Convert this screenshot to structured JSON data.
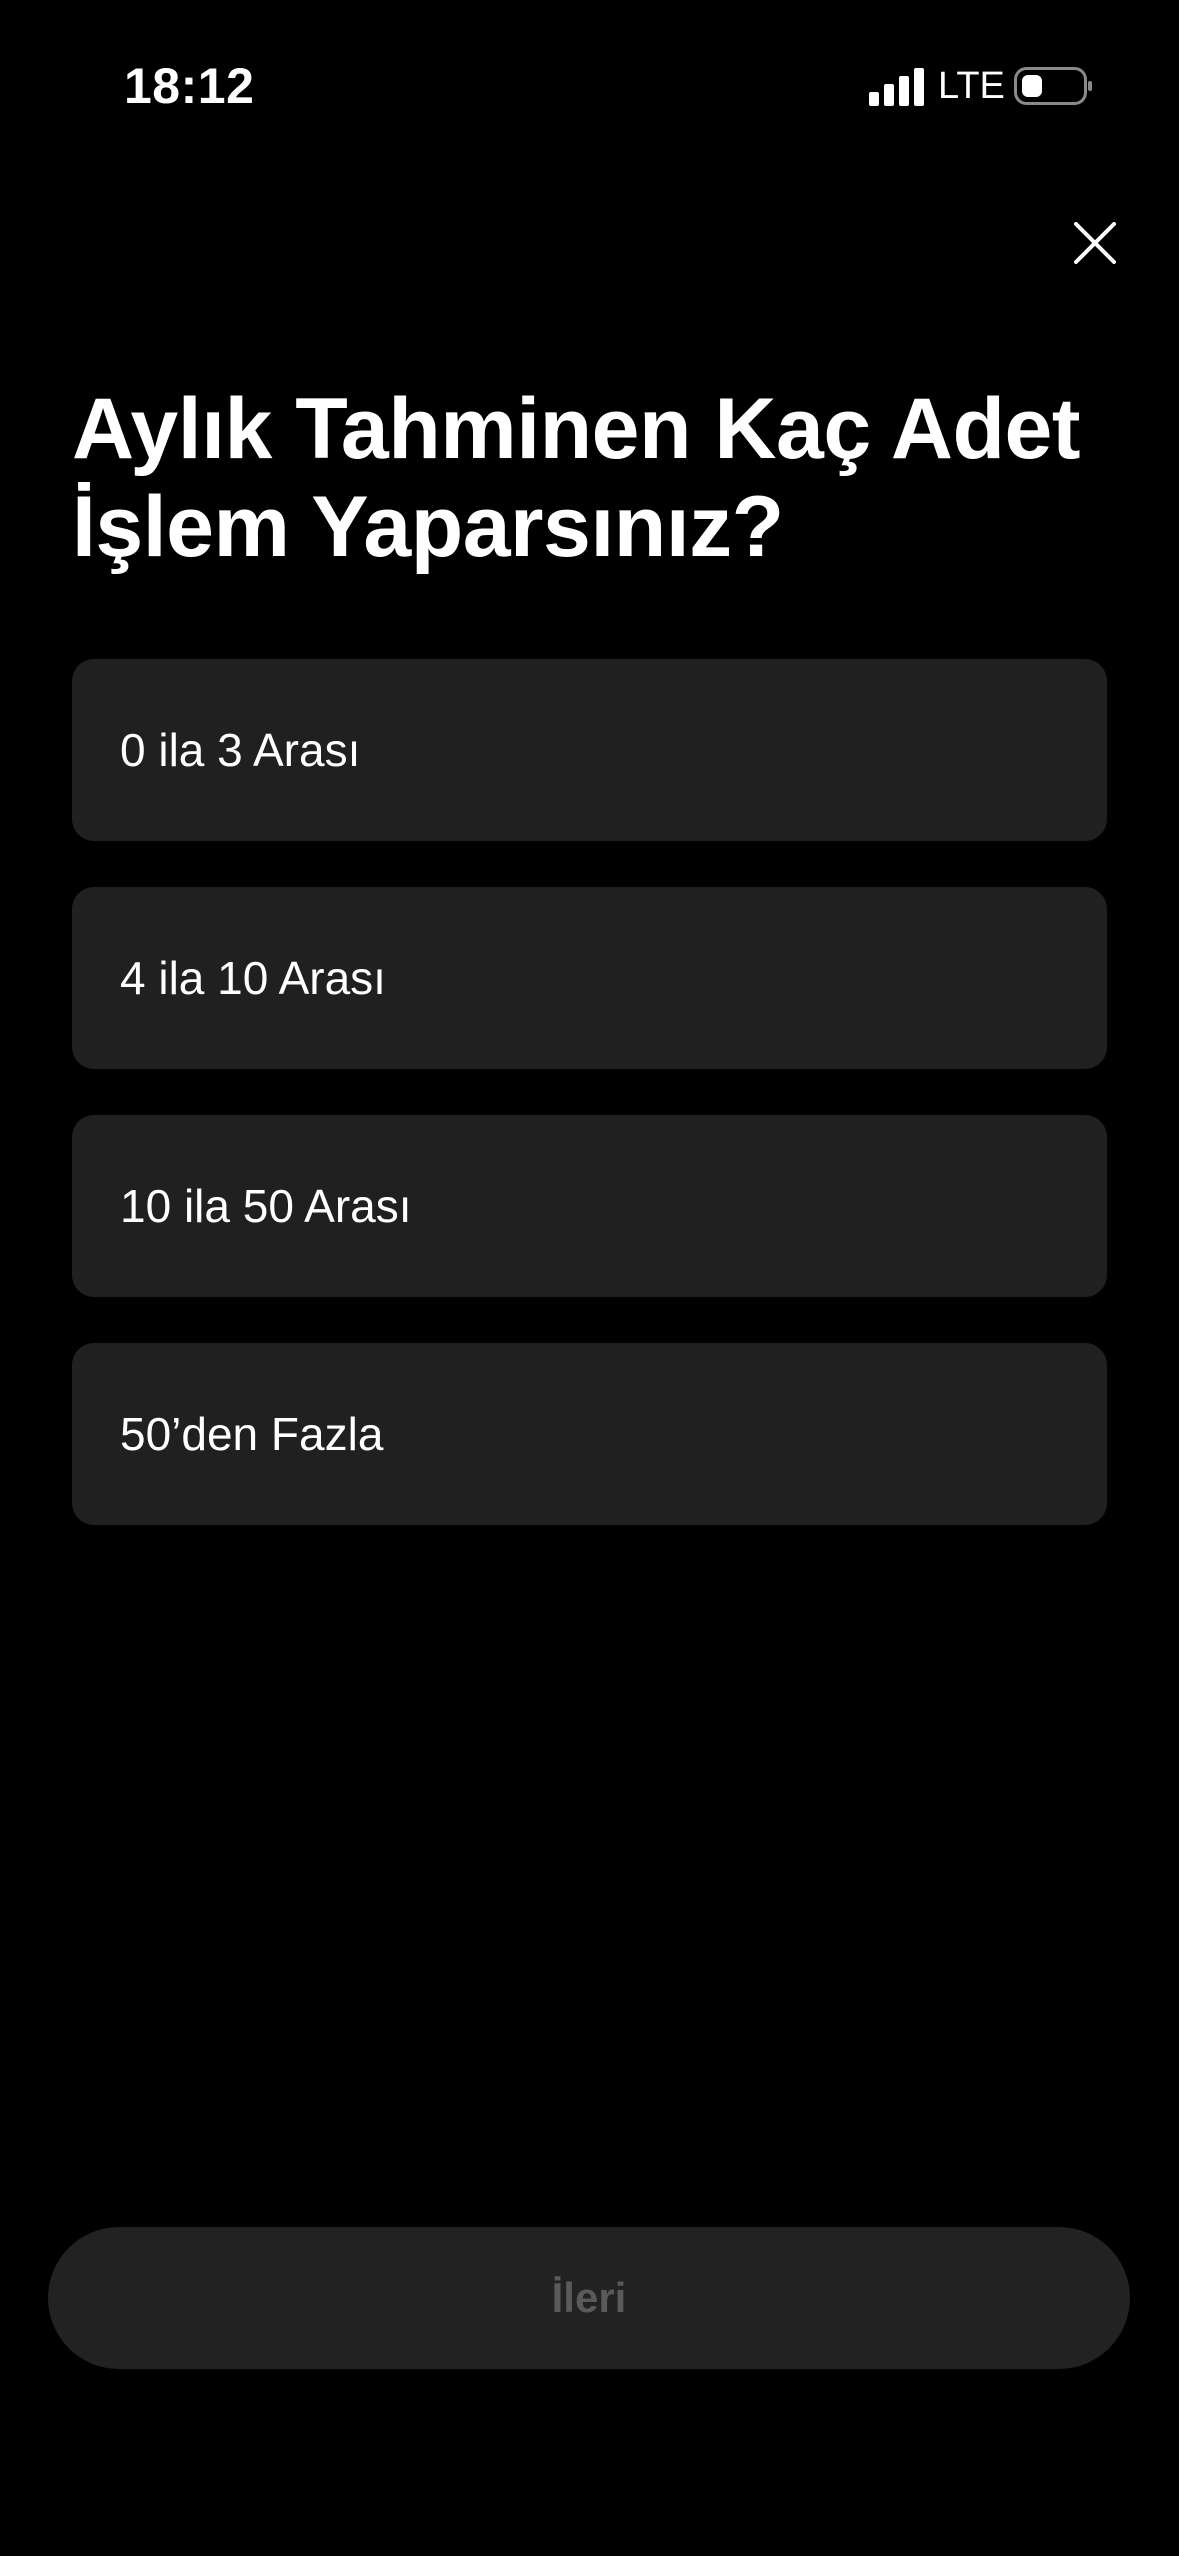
{
  "status_bar": {
    "time": "18:12",
    "network": "LTE",
    "signal_icon": "cellular-signal-icon",
    "battery_icon": "battery-icon"
  },
  "header": {
    "close_icon": "close-icon"
  },
  "question": {
    "title": "Aylık Tahminen Kaç Adet İşlem Yaparsınız?"
  },
  "options": [
    {
      "label": "0 ila 3 Arası"
    },
    {
      "label": "4 ila 10 Arası"
    },
    {
      "label": "10 ila 50 Arası"
    },
    {
      "label": "50’den Fazla"
    }
  ],
  "footer": {
    "next_label": "İleri"
  },
  "colors": {
    "background": "#000000",
    "card": "#202020",
    "button": "#222222",
    "button_text_disabled": "#5a5a5a",
    "text": "#ffffff"
  }
}
